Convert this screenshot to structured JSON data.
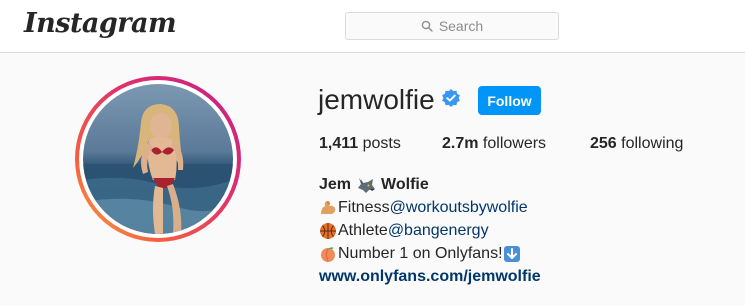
{
  "header": {
    "logo_text": "Instagram",
    "search": {
      "placeholder": "Search",
      "icon": "search-icon"
    }
  },
  "profile": {
    "username": "jemwolfie",
    "verified": true,
    "follow_label": "Follow",
    "stats": {
      "posts_count": "1,411",
      "posts_label": "posts",
      "followers_count": "2.7m",
      "followers_label": "followers",
      "following_count": "256",
      "following_label": "following"
    },
    "bio": {
      "name_first": "Jem",
      "name_last": "Wolfie",
      "name_emoji": "wolf-icon",
      "lines": [
        {
          "emoji": "flexed-bicep-icon",
          "text": "Fitness ",
          "mention": "@workoutsbywolfie"
        },
        {
          "emoji": "basketball-icon",
          "text": "Athlete ",
          "mention": "@bangenergy"
        },
        {
          "emoji": "peach-icon",
          "text": "Number 1 on Onlyfans! ",
          "trailing_emoji": "down-arrow-icon"
        }
      ],
      "link": "www.onlyfans.com/jemwolfie"
    }
  },
  "colors": {
    "follow_button": "#0095f6",
    "link": "#00376b",
    "verified_badge": "#3897f0",
    "text": "#262626"
  }
}
